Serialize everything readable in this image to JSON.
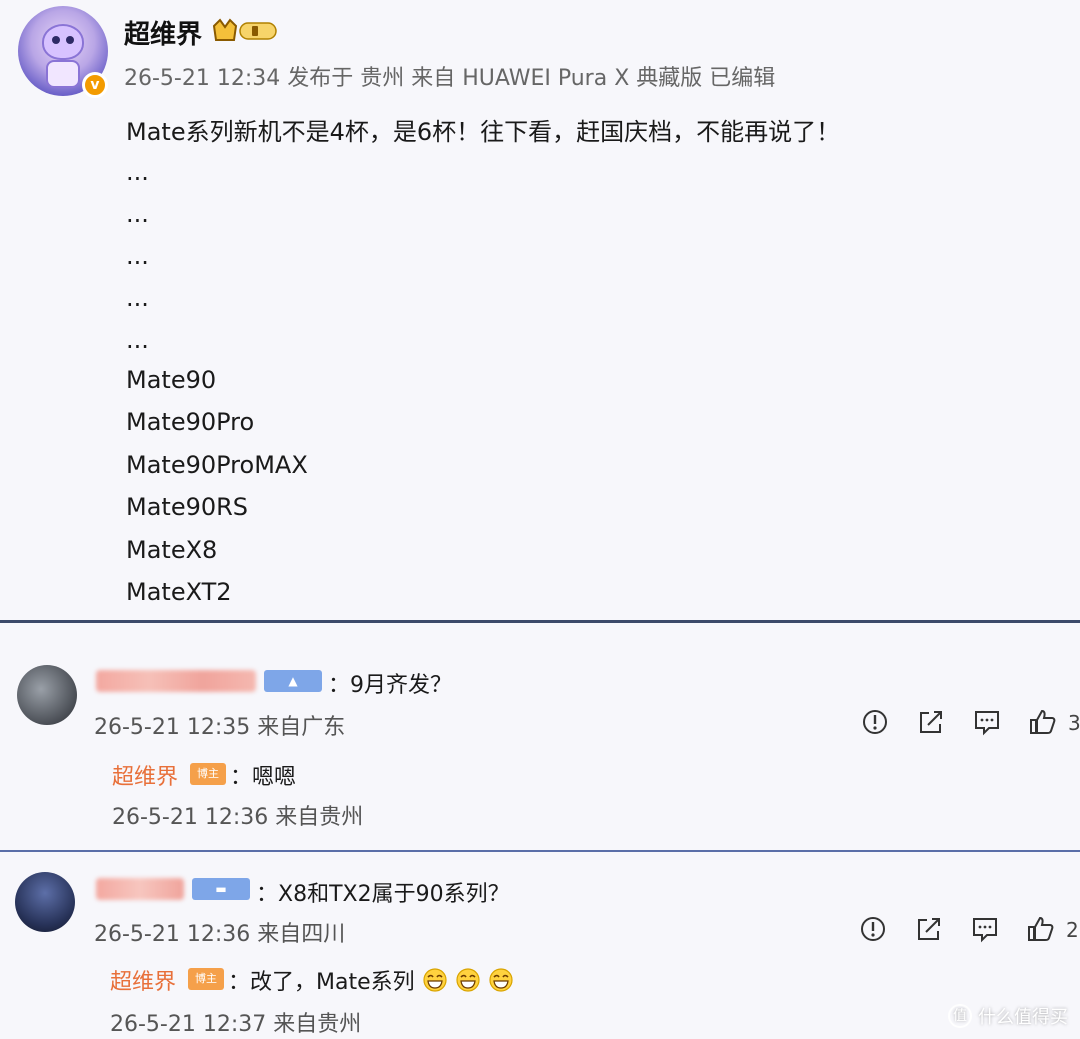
{
  "post": {
    "author": "超维界",
    "meta": "26-5-21 12:34 发布于 贵州 来自 HUAWEI Pura X 典藏版 已编辑",
    "lead": "Mate系列新机不是4杯，是6杯！往下看，赶国庆档，不能再说了！",
    "ellipses": [
      "...",
      "...",
      "...",
      "...",
      "..."
    ],
    "models": [
      "Mate90",
      "Mate90Pro",
      "Mate90ProMAX",
      "Mate90RS",
      "MateX8",
      "MateXT2"
    ]
  },
  "comments": [
    {
      "text": "：9月齐发？",
      "meta": "26-5-21 12:35 来自广东",
      "like_count": "3",
      "reply": {
        "author": "超维界",
        "host_tag": "博主",
        "text": "：嗯嗯",
        "meta": "26-5-21 12:36 来自贵州"
      }
    },
    {
      "text": "：X8和TX2属于90系列？",
      "meta": "26-5-21 12:36 来自四川",
      "like_count": "2",
      "reply": {
        "author": "超维界",
        "host_tag": "博主",
        "text": "：改了，Mate系列",
        "meta": "26-5-21 12:37 来自贵州"
      }
    }
  ],
  "watermark": "什么值得买",
  "colors": {
    "reply_author": "#e8703a",
    "host_tag": "#f5a04a",
    "user_tag": "#7ea6e8",
    "divider": "#3c4a6a"
  },
  "icons": [
    "report-icon",
    "share-icon",
    "comment-icon",
    "like-icon"
  ]
}
